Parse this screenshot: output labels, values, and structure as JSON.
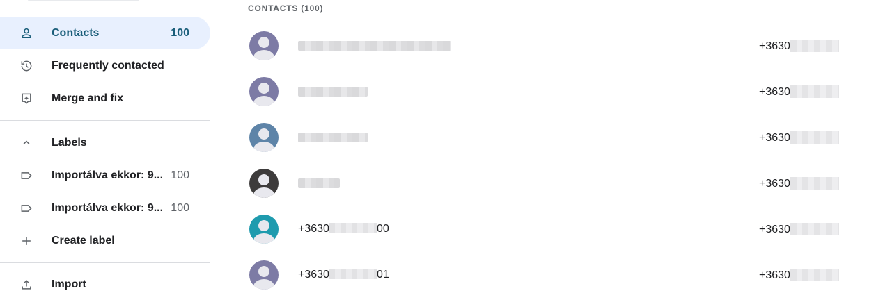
{
  "sidebar": {
    "nav": [
      {
        "label": "Contacts",
        "count": "100",
        "icon": "person-icon",
        "active": true
      },
      {
        "label": "Frequently contacted",
        "count": "",
        "icon": "history-icon",
        "active": false
      },
      {
        "label": "Merge and fix",
        "count": "",
        "icon": "merge-fix-icon",
        "active": false
      }
    ],
    "labels_header": "Labels",
    "labels": [
      {
        "label": "Importálva ekkor: 9...",
        "count": "100"
      },
      {
        "label": "Importálva ekkor: 9...",
        "count": "100"
      }
    ],
    "create_label": "Create label",
    "import": "Import"
  },
  "contacts": {
    "header": "CONTACTS (100)",
    "rows": [
      {
        "avatar_color": "#7d7ba5",
        "name": "",
        "phone_prefix": "+3630"
      },
      {
        "avatar_color": "#7d7ba5",
        "name": "",
        "phone_prefix": "+3630"
      },
      {
        "avatar_color": "#5e84a8",
        "name": "",
        "phone_prefix": "+3630"
      },
      {
        "avatar_color": "#3d3b3b",
        "name": "",
        "phone_prefix": "+3630"
      },
      {
        "avatar_color": "#1f9bae",
        "name_prefix": "+3630",
        "name_suffix": "00",
        "phone_prefix": "+3630"
      },
      {
        "avatar_color": "#7d7ba5",
        "name_prefix": "+3630",
        "name_suffix": "01",
        "phone_prefix": "+3630"
      }
    ]
  },
  "colors": {
    "active_bg": "#e8f0fe",
    "active_text": "#1a5e7a"
  }
}
